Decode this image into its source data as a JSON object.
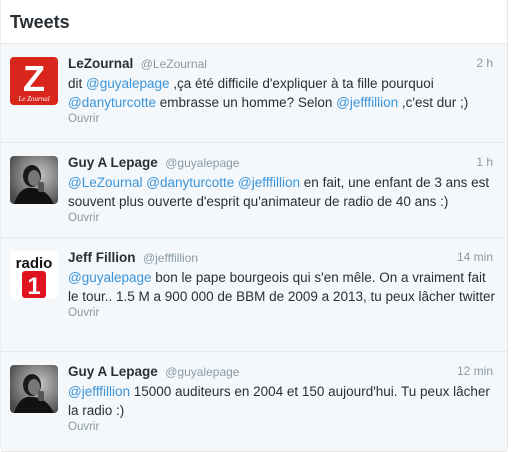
{
  "timeline": {
    "title": "Tweets",
    "tweets": [
      {
        "name": "LeZournal",
        "handle": "@LeZournal",
        "time": "2 h",
        "parts": [
          {
            "t": "text",
            "v": "dit "
          },
          {
            "t": "mention",
            "v": "@guyalepage"
          },
          {
            "t": "text",
            "v": "  ,ça été difficile d'expliquer à ta fille pourquoi "
          },
          {
            "t": "mention",
            "v": "@danyturcotte"
          },
          {
            "t": "text",
            "v": " embrasse un homme? Selon "
          },
          {
            "t": "mention",
            "v": "@jefffillion"
          },
          {
            "t": "text",
            "v": " ,c'est dur ;)"
          }
        ],
        "action": "Ouvrir",
        "avatar_icon": "lezournal-logo-icon",
        "avatar_letter": "Z",
        "avatar_sub": "Le Zournal"
      },
      {
        "name": "Guy A Lepage",
        "handle": "@guyalepage",
        "time": "1 h",
        "parts": [
          {
            "t": "mention",
            "v": "@LeZournal"
          },
          {
            "t": "text",
            "v": " "
          },
          {
            "t": "mention",
            "v": "@danyturcotte"
          },
          {
            "t": "text",
            "v": " "
          },
          {
            "t": "mention",
            "v": "@jefffillion"
          },
          {
            "t": "text",
            "v": " en fait, une enfant de 3 ans est souvent plus ouverte d'esprit qu'animateur de radio de 40 ans :)"
          }
        ],
        "action": "Ouvrir",
        "avatar_icon": "user-photo-icon"
      },
      {
        "name": "Jeff Fillion",
        "handle": "@jefffillion",
        "time": "14 min",
        "parts": [
          {
            "t": "mention",
            "v": "@guyalepage"
          },
          {
            "t": "text",
            "v": " bon le pape bourgeois qui s'en mêle. On a vraiment fait  le tour.. 1.5 M a 900 000 de BBM de 2009 a 2013, tu peux lâcher twitter"
          }
        ],
        "action": "Ouvrir",
        "avatar_icon": "radio1-logo-icon",
        "avatar_word": "radio",
        "avatar_num": "1"
      },
      {
        "name": "Guy A Lepage",
        "handle": "@guyalepage",
        "time": "12 min",
        "parts": [
          {
            "t": "mention",
            "v": "@jefffillion"
          },
          {
            "t": "text",
            "v": " 15000 auditeurs en 2004 et 150 aujourd'hui. Tu peux lâcher la radio :)"
          }
        ],
        "action": "Ouvrir",
        "avatar_icon": "user-photo-icon"
      }
    ]
  },
  "colors": {
    "mention": "#3b94d9",
    "muted": "#8899a6",
    "lezournal_red": "#d9261c",
    "radio_red": "#e0141e"
  }
}
